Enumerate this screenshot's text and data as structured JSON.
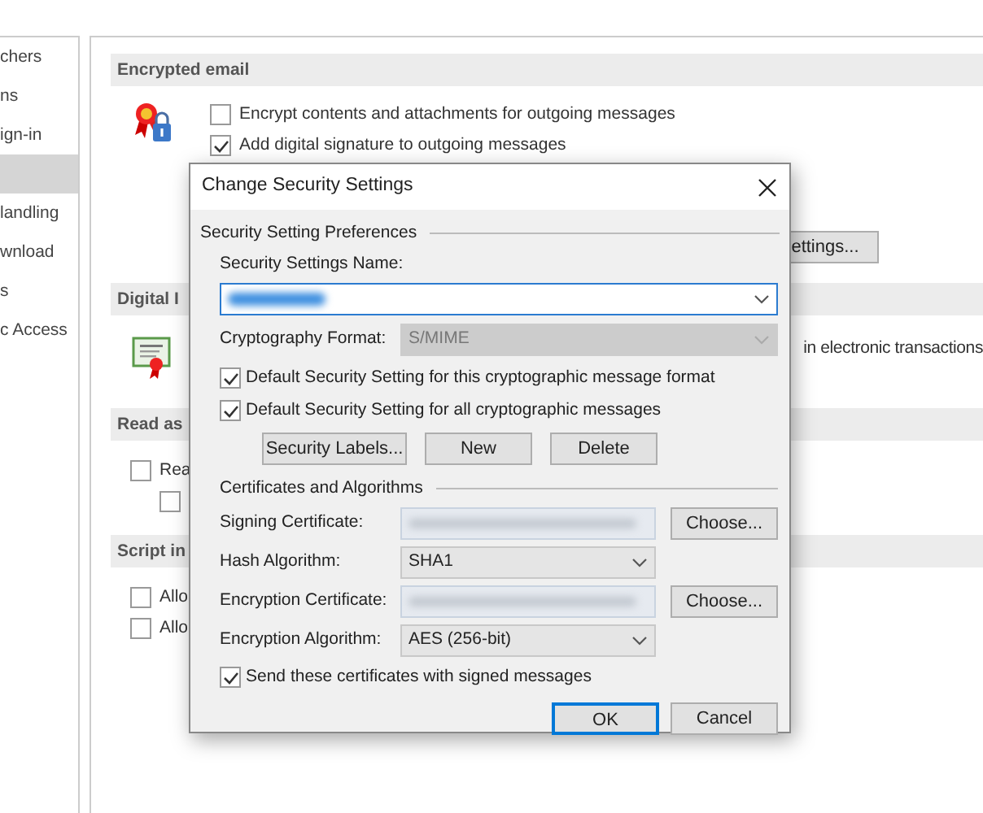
{
  "sidebar": {
    "items": [
      {
        "label": "chers",
        "selected": false
      },
      {
        "label": "ns",
        "selected": false
      },
      {
        "label": "ign-in",
        "selected": false
      },
      {
        "selected": true
      },
      {
        "label": "landling",
        "selected": false
      },
      {
        "label": "wnload",
        "selected": false
      },
      {
        "label": "s",
        "selected": false
      },
      {
        "label": "c Access",
        "selected": false
      }
    ]
  },
  "sections": [
    {
      "kind": "encrypted",
      "title": "Encrypted email",
      "options": [
        {
          "label": "Encrypt contents and attachments for outgoing messages",
          "checked": false
        },
        {
          "label": "Add digital signature to outgoing messages",
          "checked": true
        }
      ],
      "button": "ettings..."
    },
    {
      "kind": "digital-id",
      "title": "Digital I",
      "text": "in electronic transactions"
    },
    {
      "kind": "plain",
      "title": "Read as",
      "options": [
        {
          "label": "Rea",
          "checked": false,
          "children": [
            {
              "checked": false
            }
          ]
        }
      ]
    },
    {
      "kind": "plain",
      "title": "Script in",
      "options": [
        {
          "label": "Allo",
          "checked": false
        },
        {
          "label": "Allo",
          "checked": false
        }
      ]
    }
  ],
  "dialog": {
    "title": "Change Security Settings",
    "preferences": {
      "title": "Security Setting Preferences",
      "name_label": "Security Settings Name:",
      "format_label": "Cryptography Format:",
      "format_value": "S/MIME",
      "format_disabled": true,
      "defaults": [
        {
          "label": "Default Security Setting for this cryptographic message format",
          "checked": true
        },
        {
          "label": "Default Security Setting for all cryptographic messages",
          "checked": true
        }
      ],
      "buttons": [
        "Security Labels...",
        "New",
        "Delete"
      ]
    },
    "certificates": {
      "title": "Certificates and Algorithms",
      "rows": [
        {
          "kind": "certificate",
          "label": "Signing Certificate:",
          "button": "Choose..."
        },
        {
          "kind": "select",
          "label": "Hash Algorithm:",
          "value": "SHA1"
        },
        {
          "kind": "certificate",
          "label": "Encryption Certificate:",
          "button": "Choose..."
        },
        {
          "kind": "select",
          "label": "Encryption Algorithm:",
          "value": "AES (256-bit)"
        }
      ],
      "send": {
        "label": "Send these certificates with signed messages",
        "checked": true
      }
    },
    "buttons": [
      {
        "label": "OK",
        "default": true
      },
      {
        "label": "Cancel",
        "default": false
      }
    ]
  }
}
